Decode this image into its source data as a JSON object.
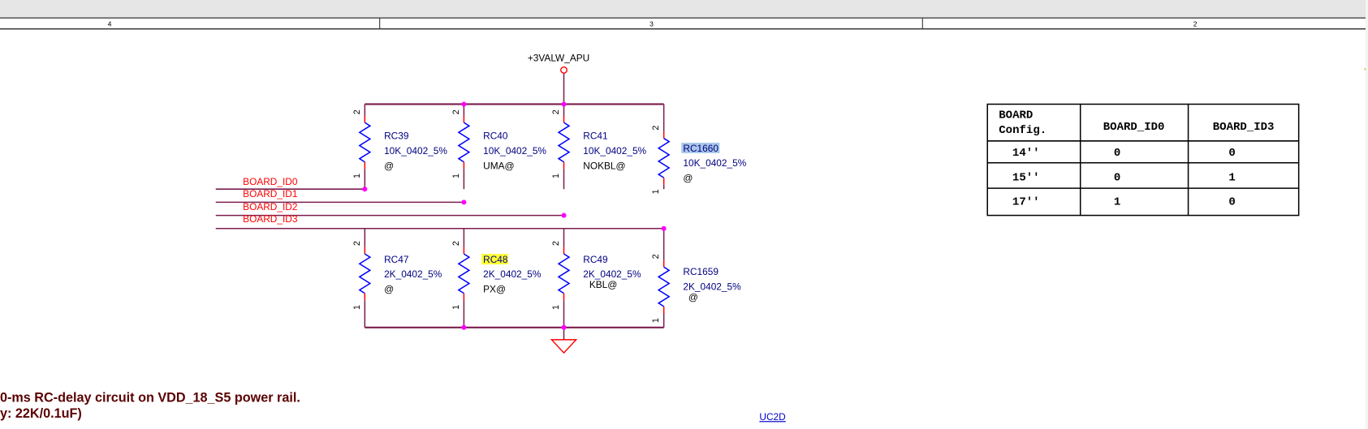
{
  "border": {
    "zones": [
      "4",
      "3",
      "2"
    ]
  },
  "power_net": "+3VALW_APU",
  "nets": [
    "BOARD_ID0",
    "BOARD_ID1",
    "BOARD_ID2",
    "BOARD_ID3"
  ],
  "upper_resistors": [
    {
      "ref": "RC39",
      "value": "10K_0402_5%",
      "option": "@",
      "highlight": ""
    },
    {
      "ref": "RC40",
      "value": "10K_0402_5%",
      "option": "UMA@",
      "highlight": ""
    },
    {
      "ref": "RC41",
      "value": "10K_0402_5%",
      "option": "NOKBL@",
      "highlight": ""
    },
    {
      "ref": "RC1660",
      "value": "10K_0402_5%",
      "option": "@",
      "highlight": "#a9c8e8"
    }
  ],
  "lower_resistors": [
    {
      "ref": "RC47",
      "value": "2K_0402_5%",
      "option": "@",
      "highlight": ""
    },
    {
      "ref": "RC48",
      "value": "2K_0402_5%",
      "option": "PX@",
      "highlight": "#ffff33"
    },
    {
      "ref": "RC49",
      "value": "2K_0402_5%",
      "option": "KBL@",
      "highlight": ""
    },
    {
      "ref": "RC1659",
      "value": "2K_0402_5%",
      "option": "@",
      "highlight": ""
    }
  ],
  "pins": {
    "top": "2",
    "bottom": "1"
  },
  "config_table": {
    "header": [
      "BOARD",
      "Config.",
      "BOARD_ID0",
      "BOARD_ID3"
    ],
    "rows": [
      [
        "14''",
        "0",
        "0"
      ],
      [
        "15''",
        "0",
        "1"
      ],
      [
        "17''",
        "1",
        "0"
      ]
    ]
  },
  "notes": [
    "0-ms RC-delay circuit on VDD_18_S5 power rail.",
    "y: 22K/0.1uF)"
  ],
  "link": "UC2D",
  "colors": {
    "wire": "#7b1e4e",
    "pin": "#ff0000",
    "resistor": "#0000ff",
    "junction": "#ff00ff",
    "label": "#000080",
    "net_label": "#ff0000",
    "note": "#5a0000"
  }
}
